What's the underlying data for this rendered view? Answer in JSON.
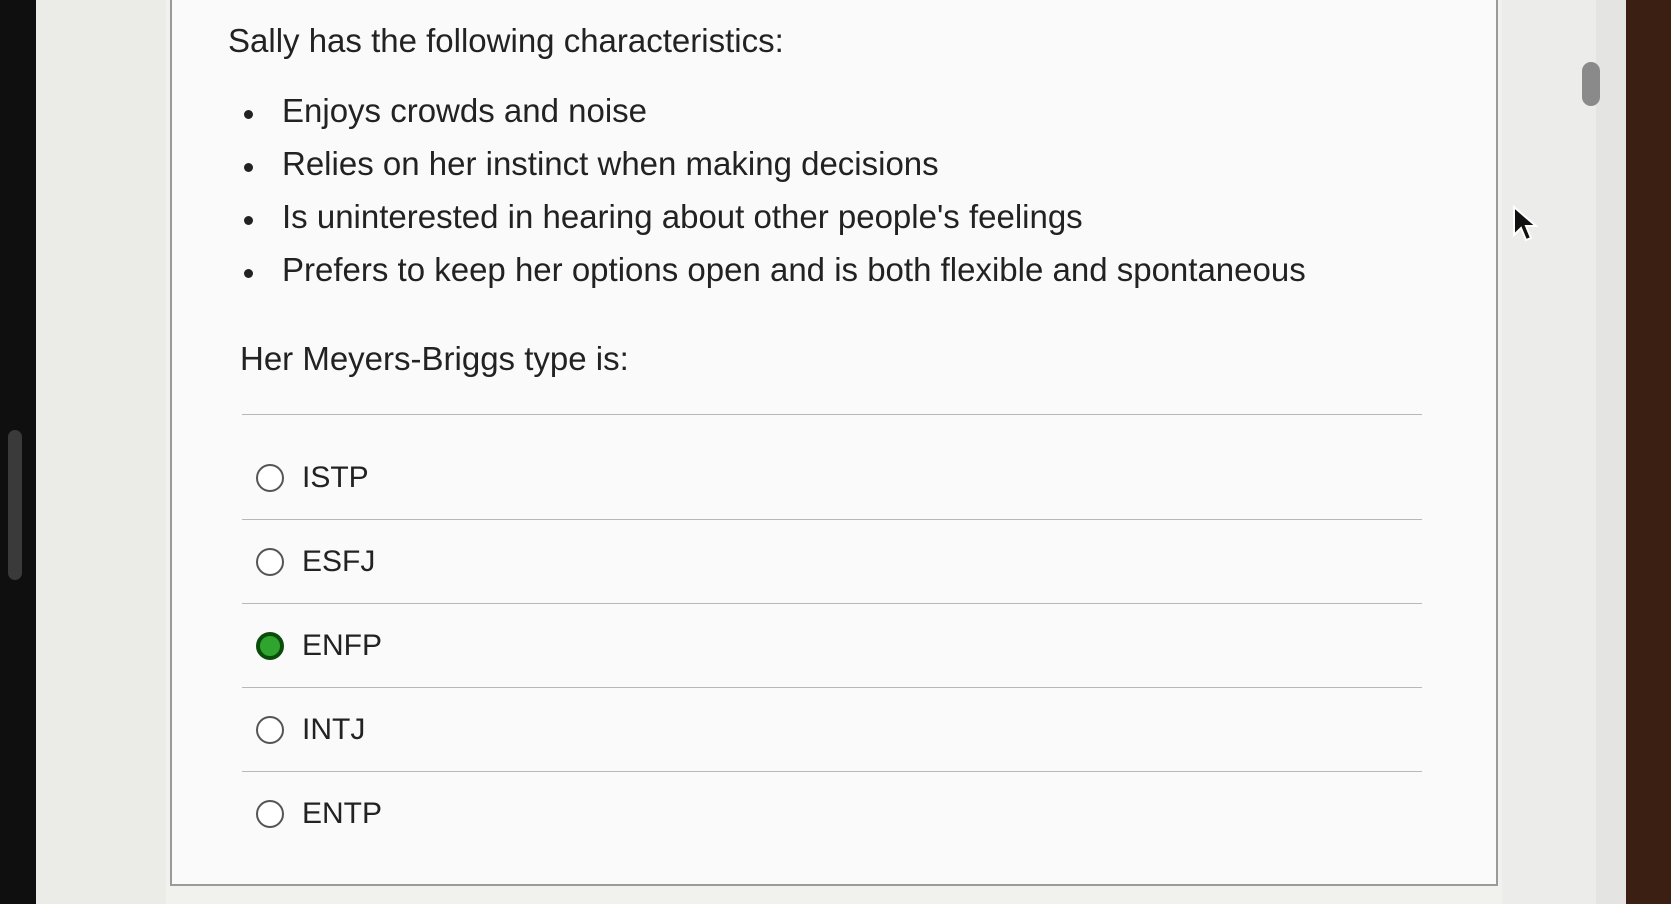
{
  "question": {
    "prompt": "Sally has the following characteristics:",
    "characteristics": [
      "Enjoys crowds and noise",
      "Relies on her instinct when making decisions",
      "Is uninterested in hearing about other people's feelings",
      "Prefers to keep her options open and is both flexible and spontaneous"
    ],
    "sub_prompt": "Her Meyers-Briggs type is:",
    "options": [
      {
        "label": "ISTP",
        "selected": false
      },
      {
        "label": "ESFJ",
        "selected": false
      },
      {
        "label": "ENFP",
        "selected": true
      },
      {
        "label": "INTJ",
        "selected": false
      },
      {
        "label": "ENTP",
        "selected": false
      }
    ]
  },
  "colors": {
    "selected_radio": "#2fa52f",
    "text": "#222222",
    "panel_border": "#9a9a9a"
  },
  "icons": {
    "cursor": "mouse-pointer-icon"
  }
}
